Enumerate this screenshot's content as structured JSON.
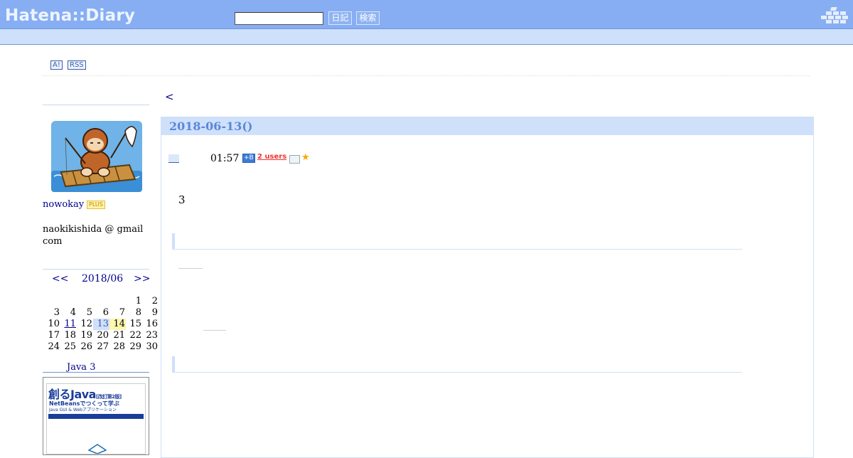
{
  "header": {
    "logo": "Hatena::Diary",
    "search_value": "",
    "diary_button": "日記",
    "search_button": "検索"
  },
  "toolbar": {
    "antenna_badge": "A!",
    "rss_badge": "RSS"
  },
  "profile": {
    "name": "nowokay",
    "plus_badge": "PLUS",
    "email": "naokikishida @ gmail com"
  },
  "calendar": {
    "prev": "<<",
    "month": "2018/06",
    "next": ">>",
    "rows": [
      [
        "",
        "",
        "",
        "",
        "",
        "1",
        "2"
      ],
      [
        "3",
        "4",
        "5",
        "6",
        "7",
        "8",
        "9"
      ],
      [
        "10",
        "11",
        "12",
        "13",
        "14",
        "15",
        "16"
      ],
      [
        "17",
        "18",
        "19",
        "20",
        "21",
        "22",
        "23"
      ],
      [
        "24",
        "25",
        "26",
        "27",
        "28",
        "29",
        "30"
      ]
    ],
    "linked_day": "11",
    "selected_day": "13",
    "today": "14"
  },
  "book": {
    "title_link": "Java 3",
    "cover_heading": "創るJava",
    "cover_edition": "[改訂第2版]",
    "cover_sub": "NetBeansでつくって学ぶ",
    "cover_sub2": "Java GUI & Webアプリケーション"
  },
  "main": {
    "prev_link": "<",
    "day_date": "2018-06-13()",
    "entry": {
      "time": "01:57",
      "bookmark_icon": "+B",
      "users": "2 users",
      "star": "★"
    },
    "body_text": "3"
  },
  "colors": {
    "header_bg": "#87aef3",
    "subbar_bg": "#cfe0fb",
    "link": "#00008b",
    "users_badge": "#ee3333"
  }
}
